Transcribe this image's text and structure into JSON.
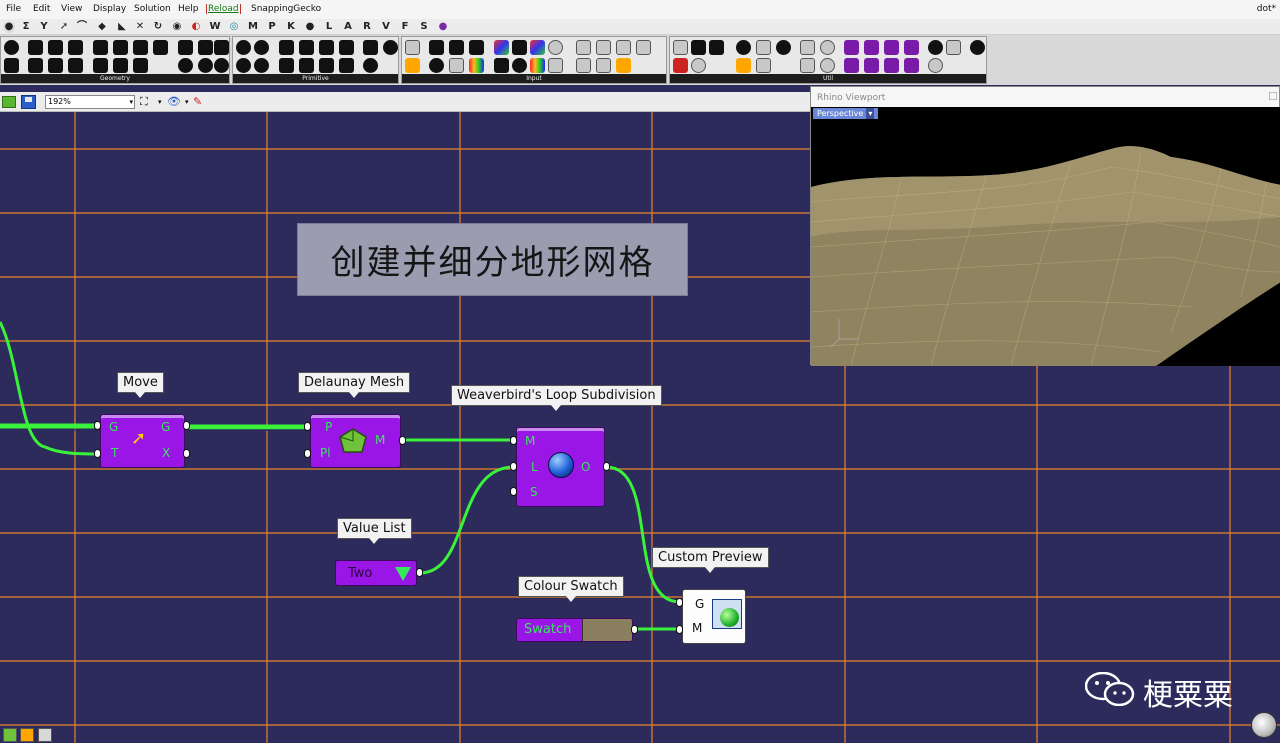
{
  "menu": {
    "file": "File",
    "edit": "Edit",
    "view": "View",
    "display": "Display",
    "solution": "Solution",
    "help": "Help",
    "reload": "Reload",
    "snapping": "SnappingGecko",
    "right_text": "dot*"
  },
  "categories": [
    "Σ",
    "Y",
    "W",
    "M",
    "P",
    "K",
    "L",
    "A",
    "R",
    "V",
    "F",
    "S"
  ],
  "toolbar": {
    "panels": [
      "Geometry",
      "Primitive",
      "Input",
      "Util"
    ]
  },
  "canvas_toolbar": {
    "zoom_value": "192%"
  },
  "title": "创建并细分地形网格",
  "components": {
    "move": {
      "label": "Move",
      "inputs": [
        "G",
        "T"
      ],
      "outputs": [
        "G",
        "X"
      ]
    },
    "delaunay": {
      "label": "Delaunay Mesh",
      "inputs": [
        "P",
        "Pl"
      ],
      "outputs": [
        "M"
      ]
    },
    "weaverbird": {
      "label": "Weaverbird's Loop Subdivision",
      "inputs": [
        "M",
        "L",
        "S"
      ],
      "outputs": [
        "O"
      ]
    },
    "value_list": {
      "label": "Value List",
      "value": "Two"
    },
    "colour_swatch": {
      "label": "Colour Swatch",
      "text": "Swatch",
      "color": "#8a7f5f"
    },
    "custom_preview": {
      "label": "Custom Preview",
      "inputs": [
        "G",
        "M"
      ]
    }
  },
  "rhino_viewport": {
    "title": "Rhino Viewport",
    "view_tab": "Perspective"
  },
  "watermark": "梗粟粟",
  "colors": {
    "canvas_bg": "#2c2b5c",
    "grid": "#e8822a",
    "wire": "#3af23a",
    "component": "#9a16e6",
    "port_text": "#35e85c",
    "terrain": "#9e916a"
  }
}
